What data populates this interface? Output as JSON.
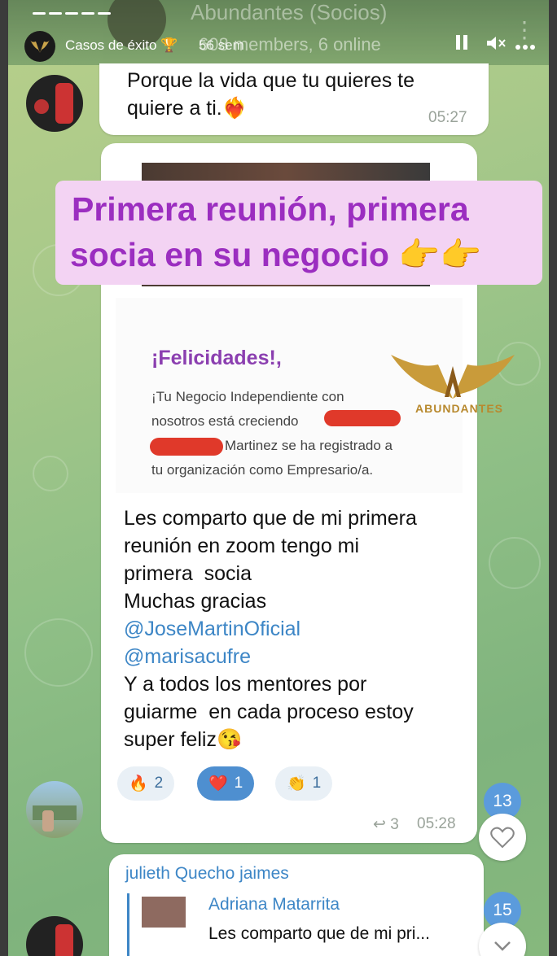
{
  "story": {
    "name": "Casos de éxito",
    "name_emoji": "🏆",
    "time": "56 sem",
    "progress_segments": 5
  },
  "chat": {
    "title": "Abundantes (Socios)",
    "members": "608 members, 6 online"
  },
  "messages": {
    "m1": {
      "lines": "Porque la vida que tu quieres te\nquiere a ti.",
      "emoji": "❤️‍🔥",
      "time": "05:27"
    },
    "m2": {
      "lines": "Les comparto que de mi primera\nreunión en zoom tengo mi\nprimera  socia\nMuchas gracias",
      "mention1": "@JoseMartinOficial",
      "mention2": "@marisacufre",
      "lines_after": "Y a todos los mentores por\nguiarme  en cada proceso estoy\nsuper feliz",
      "end_emoji": "😘",
      "forwards": "3",
      "time": "05:28",
      "reactions": [
        {
          "emoji": "🔥",
          "count": "2"
        },
        {
          "emoji": "❤️",
          "count": "1"
        },
        {
          "emoji": "👏",
          "count": "1"
        }
      ]
    },
    "m3": {
      "sender": "julieth Quecho jaimes",
      "reply_name": "Adriana Matarrita",
      "reply_text": "Les comparto que de mi pri..."
    }
  },
  "document": {
    "heading": "¡Felicidades!,",
    "line1": "¡Tu Negocio Independiente con",
    "line2": "nosotros está creciendo",
    "line3": "Martinez se ha registrado a",
    "line4": "tu organización como Empresario/a."
  },
  "overlay": {
    "line1": "Primera reunión, primera",
    "line2": "socia en su negocio",
    "emoji": "👉👉"
  },
  "logo": {
    "text": "ABUNDANTES"
  },
  "badges": {
    "b1": "13",
    "b2": "15"
  },
  "colors": {
    "accent": "#9b2ec0",
    "mention": "#3d86c6",
    "badge": "#5b9bdc"
  }
}
